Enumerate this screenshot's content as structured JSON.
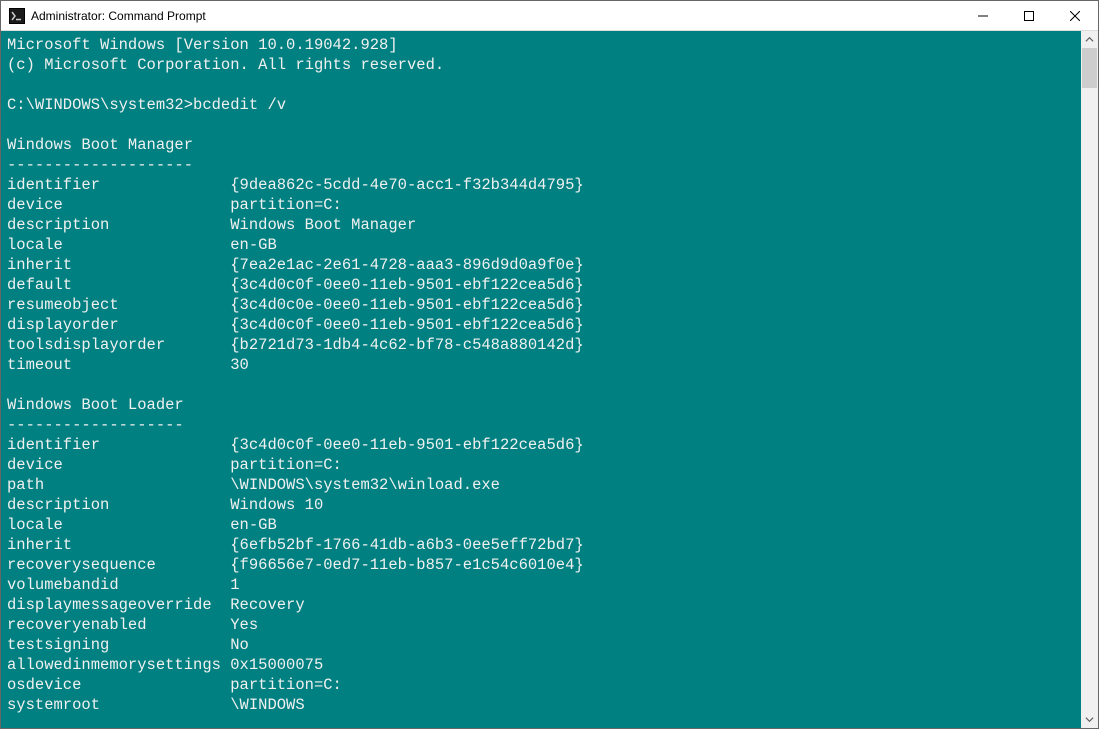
{
  "window": {
    "title": "Administrator: Command Prompt"
  },
  "terminal": {
    "headerLine1": "Microsoft Windows [Version 10.0.19042.928]",
    "headerLine2": "(c) Microsoft Corporation. All rights reserved.",
    "prompt": "C:\\WINDOWS\\system32>",
    "command": "bcdedit /v",
    "sections": [
      {
        "title": "Windows Boot Manager",
        "underline": "--------------------",
        "rows": [
          {
            "k": "identifier",
            "v": "{9dea862c-5cdd-4e70-acc1-f32b344d4795}"
          },
          {
            "k": "device",
            "v": "partition=C:"
          },
          {
            "k": "description",
            "v": "Windows Boot Manager"
          },
          {
            "k": "locale",
            "v": "en-GB"
          },
          {
            "k": "inherit",
            "v": "{7ea2e1ac-2e61-4728-aaa3-896d9d0a9f0e}"
          },
          {
            "k": "default",
            "v": "{3c4d0c0f-0ee0-11eb-9501-ebf122cea5d6}"
          },
          {
            "k": "resumeobject",
            "v": "{3c4d0c0e-0ee0-11eb-9501-ebf122cea5d6}"
          },
          {
            "k": "displayorder",
            "v": "{3c4d0c0f-0ee0-11eb-9501-ebf122cea5d6}"
          },
          {
            "k": "toolsdisplayorder",
            "v": "{b2721d73-1db4-4c62-bf78-c548a880142d}"
          },
          {
            "k": "timeout",
            "v": "30"
          }
        ]
      },
      {
        "title": "Windows Boot Loader",
        "underline": "-------------------",
        "rows": [
          {
            "k": "identifier",
            "v": "{3c4d0c0f-0ee0-11eb-9501-ebf122cea5d6}"
          },
          {
            "k": "device",
            "v": "partition=C:"
          },
          {
            "k": "path",
            "v": "\\WINDOWS\\system32\\winload.exe"
          },
          {
            "k": "description",
            "v": "Windows 10"
          },
          {
            "k": "locale",
            "v": "en-GB"
          },
          {
            "k": "inherit",
            "v": "{6efb52bf-1766-41db-a6b3-0ee5eff72bd7}"
          },
          {
            "k": "recoverysequence",
            "v": "{f96656e7-0ed7-11eb-b857-e1c54c6010e4}"
          },
          {
            "k": "volumebandid",
            "v": "1"
          },
          {
            "k": "displaymessageoverride",
            "v": "Recovery"
          },
          {
            "k": "recoveryenabled",
            "v": "Yes"
          },
          {
            "k": "testsigning",
            "v": "No"
          },
          {
            "k": "allowedinmemorysettings",
            "v": "0x15000075"
          },
          {
            "k": "osdevice",
            "v": "partition=C:"
          },
          {
            "k": "systemroot",
            "v": "\\WINDOWS"
          }
        ]
      }
    ],
    "keyColWidth": 24
  }
}
